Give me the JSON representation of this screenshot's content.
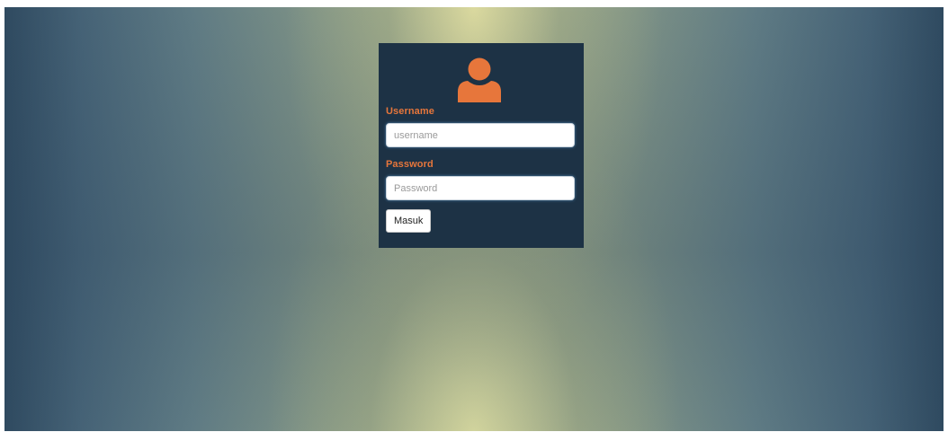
{
  "login": {
    "avatar_icon": "user-icon",
    "username_label": "Username",
    "username_placeholder": "username",
    "username_value": "",
    "password_label": "Password",
    "password_placeholder": "Password",
    "password_value": "",
    "submit_label": "Masuk"
  },
  "colors": {
    "card_background": "#1d3245",
    "accent": "#e7763b",
    "button_background": "#ffffff"
  }
}
